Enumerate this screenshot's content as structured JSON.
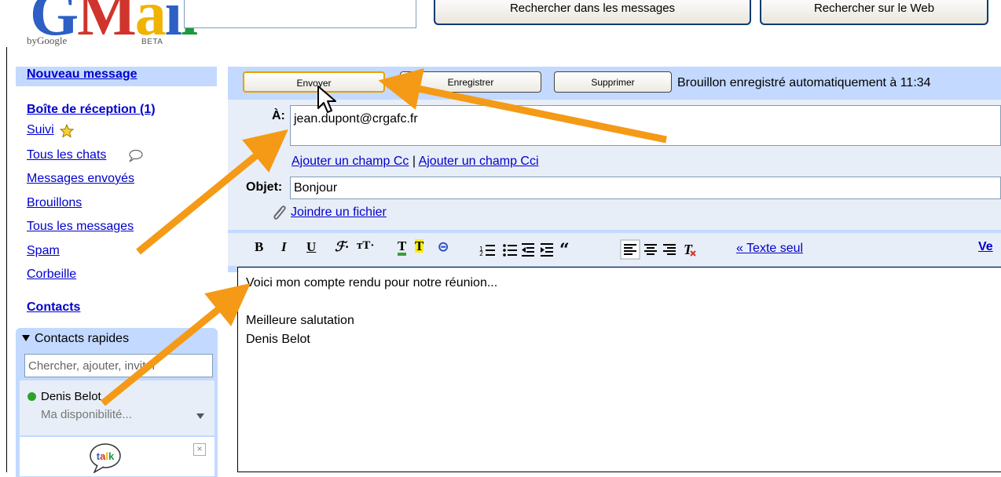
{
  "header": {
    "logo_letters": [
      "G",
      "M",
      "a",
      "i",
      "l"
    ],
    "by_google": "byGoogle",
    "beta": "BETA",
    "search_mail_button": "Rechercher dans les messages",
    "search_web_button": "Rechercher sur le Web"
  },
  "sidebar": {
    "compose": "Nouveau message",
    "inbox": "Boîte de réception (1)",
    "starred": "Suivi",
    "chats": "Tous les chats",
    "sent": "Messages envoyés",
    "drafts": "Brouillons",
    "all_mail": "Tous les messages",
    "spam": "Spam",
    "trash": "Corbeille",
    "contacts": "Contacts"
  },
  "quick_contacts": {
    "title": "Contacts rapides",
    "search_placeholder": "Chercher, ajouter, inviter",
    "contact_name": "Denis Belot",
    "status": "Ma disponibilité...",
    "talk_logo": "talk"
  },
  "compose": {
    "send": "Envoyer",
    "save": "Enregistrer",
    "delete": "Supprimer",
    "autosave": "Brouillon enregistré automatiquement à 11:34",
    "to_label": "À:",
    "to_value": "jean.dupont@crgafc.fr",
    "add_cc": "Ajouter un champ Cc",
    "separator": "|",
    "add_bcc": "Ajouter un champ Cci",
    "subject_label": "Objet:",
    "subject_value": "Bonjour",
    "attach": "Joindre un fichier",
    "plain_text": "« Texte seul",
    "spell_partial": "Ve",
    "body_lines": [
      "Voici mon compte rendu pour notre réunion...",
      "",
      "Meilleure salutation",
      "Denis Belot"
    ]
  },
  "toolbar": {
    "bold": "B",
    "italic": "I",
    "underline": "U",
    "font": "ℱ·",
    "size": "тT·",
    "text_color": "T",
    "highlight": "T",
    "link": "⊝"
  },
  "colors": {
    "accent_blue": "#c3d9ff",
    "pale_blue": "#e8eef7",
    "arrow_orange": "#f59a16",
    "link_blue": "#0000cc"
  }
}
